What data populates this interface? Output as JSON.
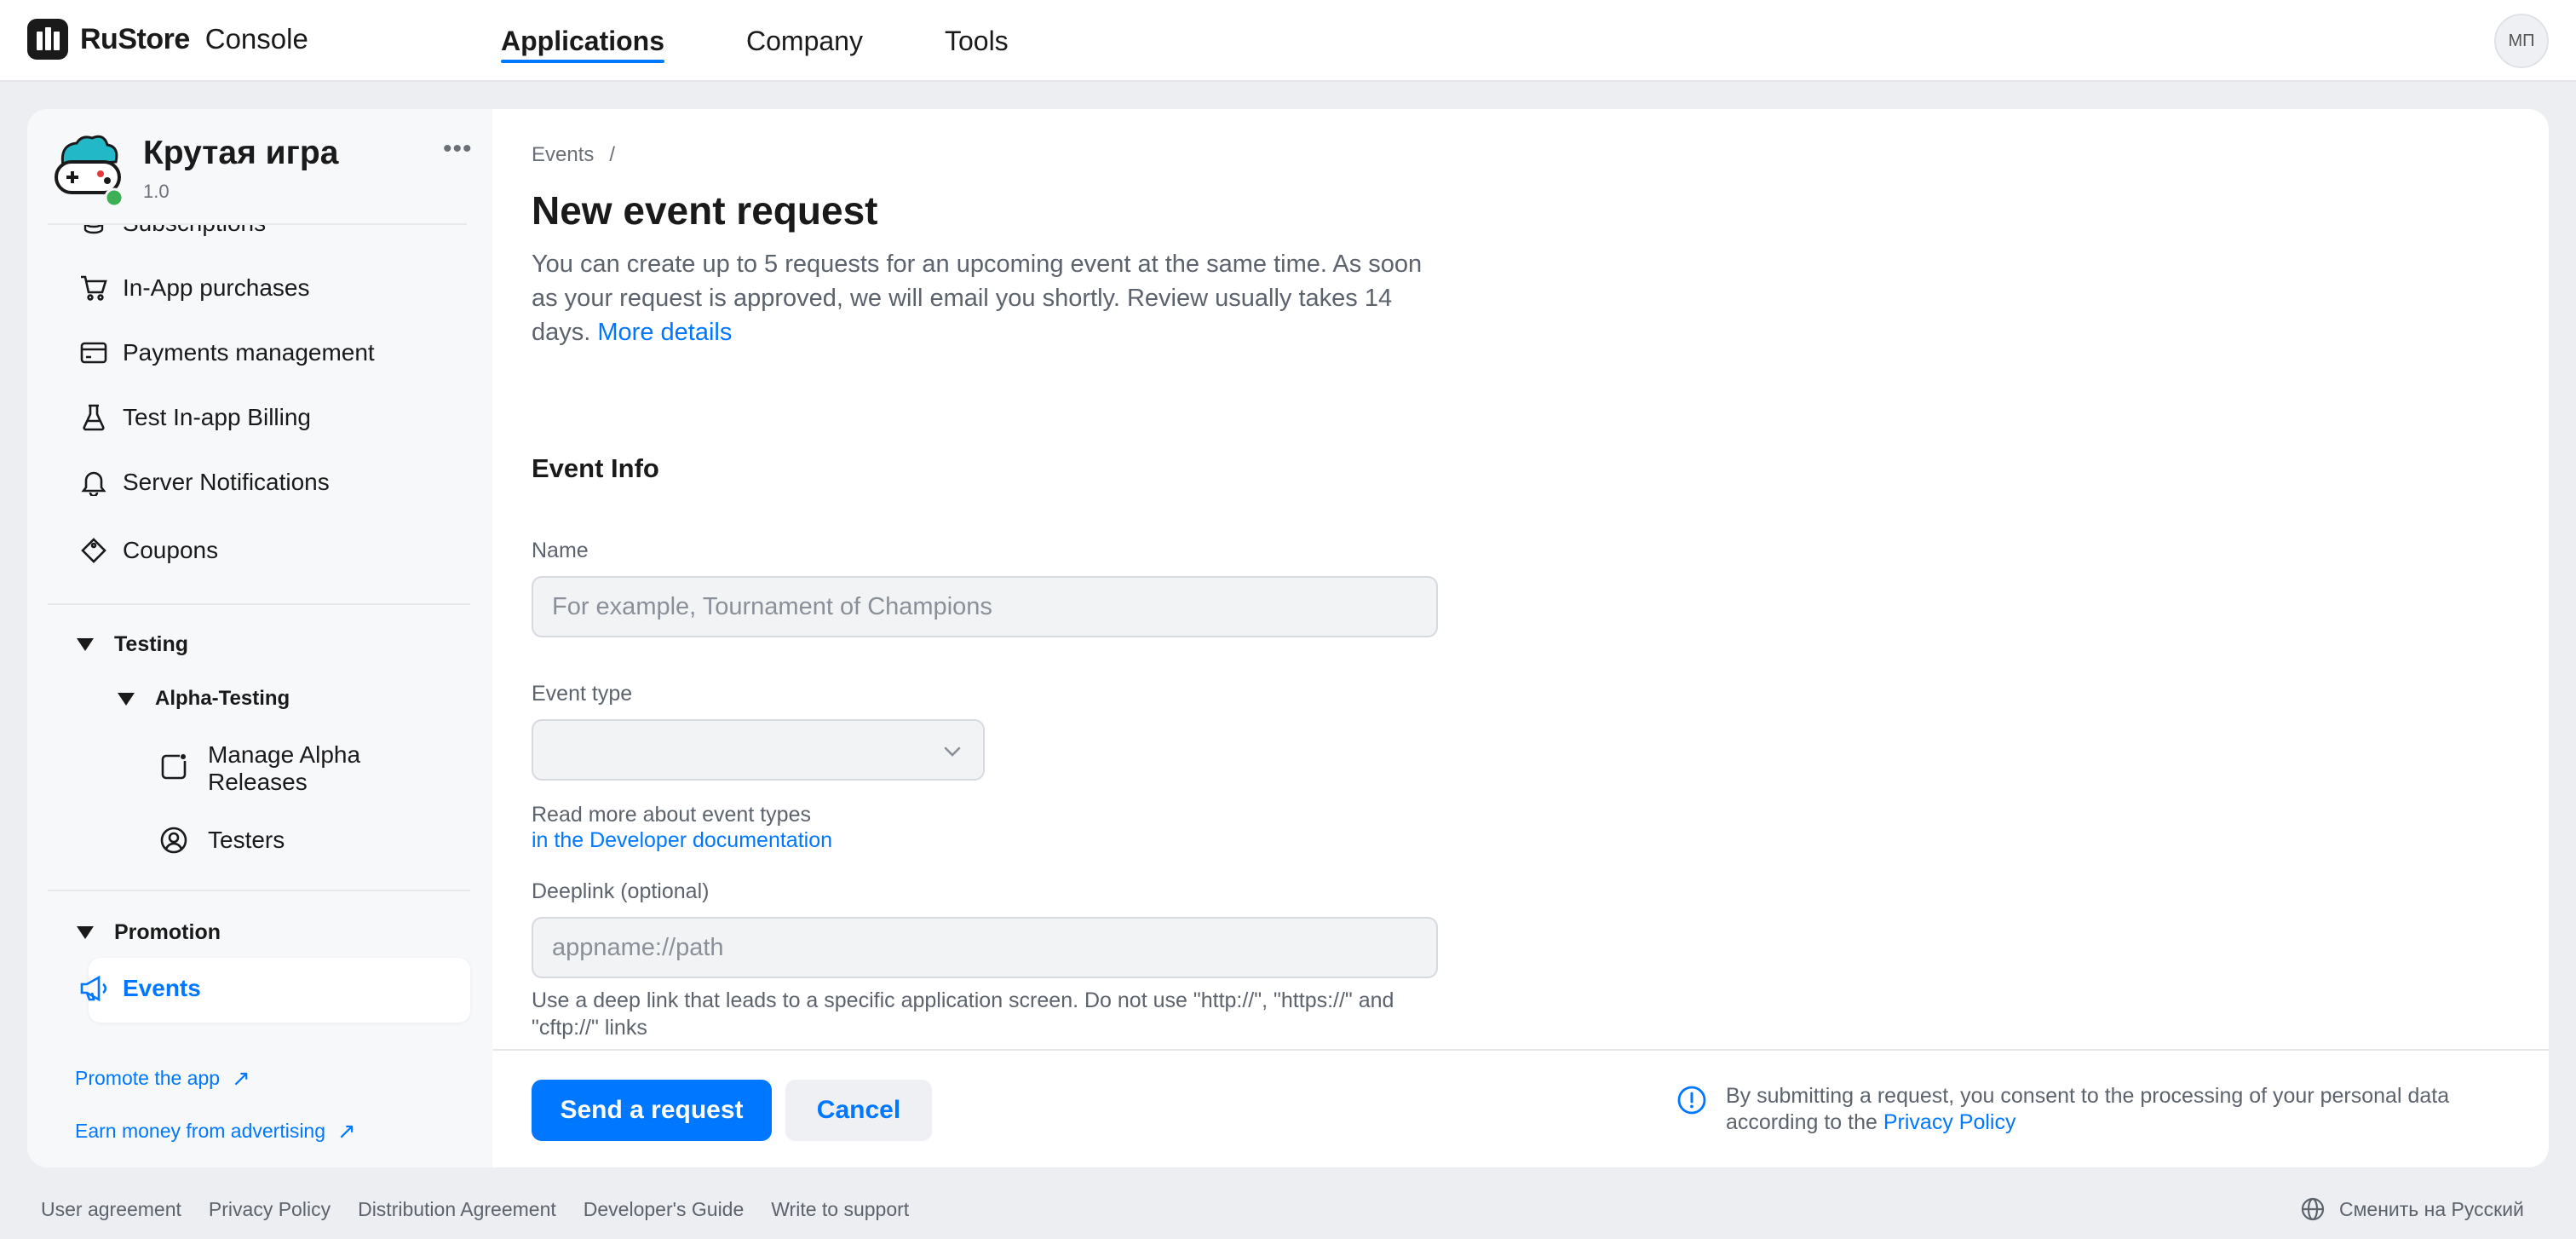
{
  "header": {
    "brand": "RuStore",
    "brand_sub": "Console",
    "nav": [
      "Applications",
      "Company",
      "Tools"
    ],
    "active_nav": "Applications",
    "avatar_initials": "МП"
  },
  "app": {
    "name": "Крутая игра",
    "version": "1.0",
    "status_color": "#3cb054"
  },
  "sidebar": {
    "items": [
      {
        "label": "Subscriptions",
        "icon": "coins-icon"
      },
      {
        "label": "In-App purchases",
        "icon": "cart-icon"
      },
      {
        "label": "Payments management",
        "icon": "card-icon"
      },
      {
        "label": "Test In-app Billing",
        "icon": "flask-icon"
      },
      {
        "label": "Server Notifications",
        "icon": "bell-icon"
      },
      {
        "label": "Coupons",
        "icon": "ticket-icon"
      }
    ],
    "testing": {
      "label": "Testing",
      "group": "Alpha-Testing",
      "items": [
        {
          "label": "Manage Alpha Releases",
          "icon": "release-icon"
        },
        {
          "label": "Testers",
          "icon": "user-circle-icon"
        }
      ]
    },
    "promotion": {
      "label": "Promotion",
      "items": [
        {
          "label": "Events",
          "icon": "megaphone-icon"
        }
      ]
    },
    "links": [
      "Promote the app",
      "Earn money from advertising"
    ]
  },
  "main": {
    "breadcrumb": [
      "Events"
    ],
    "title": "New event request",
    "lead": "You can create up to 5 requests for an upcoming event at the same time. As soon as your request is approved, we will email you shortly. Review usually takes 14 days.",
    "lead_link": "More details",
    "section_title": "Event Info",
    "name_label": "Name",
    "name_value": "",
    "name_placeholder": "For example, Tournament of Champions",
    "type_label": "Event type",
    "type_value": "",
    "type_help": "Read more about event types",
    "type_help_link": "in the Developer documentation",
    "deeplink_label": "Deeplink (optional)",
    "deeplink_value": "",
    "deeplink_placeholder": "appname://path",
    "deeplink_help": "Use a deep link that leads to a specific application screen. Do not use \"http://\", \"https://\" and \"cftp://\" links",
    "submit_label": "Send a request",
    "cancel_label": "Cancel",
    "consent_text": "By submitting a request, you consent to the processing of your personal data according to the",
    "consent_link": "Privacy Policy"
  },
  "footer": {
    "links": [
      "User agreement",
      "Privacy Policy",
      "Distribution Agreement",
      "Developer's Guide",
      "Write to support"
    ],
    "language": "Сменить на Русский"
  },
  "colors": {
    "accent": "#0077ff",
    "background": "#eceef1",
    "sidebar_bg": "#f7f8fa"
  }
}
